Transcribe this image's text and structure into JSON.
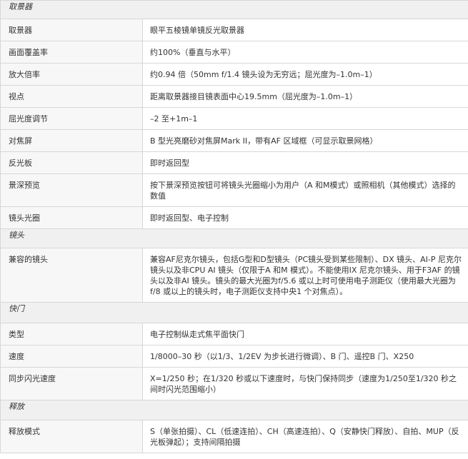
{
  "sections": [
    {
      "title": "取景器",
      "rows": [
        {
          "label": "取景器",
          "value": "眼平五棱镜单镜反光取景器"
        },
        {
          "label": "画面覆盖率",
          "value": "约100%（垂直与水平）"
        },
        {
          "label": "放大倍率",
          "value": "约0.94 倍（50mm f/1.4 镜头设为无穷远；屈光度为–1.0m–1）"
        },
        {
          "label": "视点",
          "value": "距离取景器接目镜表面中心19.5mm（屈光度为–1.0m–1）"
        },
        {
          "label": "屈光度调节",
          "value": "–2 至+1m–1"
        },
        {
          "label": "对焦屏",
          "value": "B 型光亮磨砂对焦屏Mark II，带有AF 区域框（可显示取景网格）"
        },
        {
          "label": "反光板",
          "value": "即时返回型"
        },
        {
          "label": "景深预览",
          "value": "按下景深预览按钮可将镜头光圈缩小为用户（A 和M模式）或照相机（其他模式）选择的数值"
        },
        {
          "label": "镜头光圈",
          "value": "即时返回型、电子控制"
        }
      ]
    },
    {
      "title": "镜头",
      "rows": [
        {
          "label": "兼容的镜头",
          "value": "兼容AF尼克尔镜头，包括G型和D型镜头（PC镜头受到某些限制）、DX 镜头、AI-P 尼克尔镜头以及非CPU AI 镜头（仅限于A 和M 模式）。不能使用IX 尼克尔镜头、用于F3AF 的镜头以及非AI 镜头。镜头的最大光圈为f/5.6 或以上时可使用电子测距仪（使用最大光圈为f/8 或以上的镜头时，电子测距仪支持中央1 个对焦点）。"
        }
      ]
    },
    {
      "title": "快门",
      "rows": [
        {
          "label": "类型",
          "value": "电子控制纵走式焦平面快门"
        },
        {
          "label": "速度",
          "value": "1/8000–30 秒（以1/3、1/2EV 为步长进行微调）、B 门、遥控B 门、X250"
        },
        {
          "label": "同步闪光速度",
          "value": "X=1/250 秒；在1/320 秒或以下速度时，与快门保持同步（速度为1/250至1/320 秒之间时闪光范围缩小）"
        }
      ]
    },
    {
      "title": "释放",
      "rows": [
        {
          "label": "释放模式",
          "value": "S（单张拍摄）、CL（低速连拍）、CH（高速连拍）、Q（安静快门释放）、自拍、MUP（反光板弹起）；支持间隔拍摄"
        }
      ]
    }
  ]
}
